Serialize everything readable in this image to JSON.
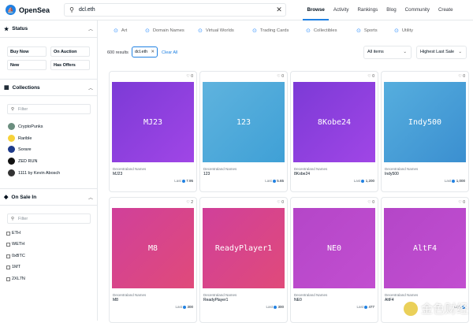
{
  "header": {
    "logo_text": "OpenSea",
    "search_value": "dcl.eth",
    "nav": [
      "Browse",
      "Activity",
      "Rankings",
      "Blog",
      "Community",
      "Create"
    ]
  },
  "sidebar": {
    "status_title": "Status",
    "status_buttons": [
      "Buy Now",
      "On Auction",
      "New",
      "Has Offers"
    ],
    "collections_title": "Collections",
    "collections_filter_placeholder": "Filter",
    "collections": [
      "CryptoPunks",
      "Rarible",
      "Sorare",
      "ZED RUN",
      "1111 by Kevin Abosch"
    ],
    "onsale_title": "On Sale In",
    "onsale_filter_placeholder": "Filter",
    "currencies": [
      "ETH",
      "WETH",
      "0xBTC",
      "1MT",
      "2XL7N"
    ]
  },
  "categories": [
    "Art",
    "Domain Names",
    "Virtual Worlds",
    "Trading Cards",
    "Collectibles",
    "Sports",
    "Utility"
  ],
  "results": {
    "count_text": "600 results",
    "chip": "dcl.eth",
    "clear_all": "Clear All",
    "sort_items": "All items",
    "sort_order": "Highest Last Sale"
  },
  "cards": [
    {
      "title": "MJ23",
      "collection": "Decentraland Names",
      "name": "MJ23",
      "last_label": "Last",
      "last": "7.95",
      "favs": "0",
      "color1": "#7c3ad6",
      "color2": "#a046e6"
    },
    {
      "title": "123",
      "collection": "Decentraland Names",
      "name": "123",
      "last_label": "Last",
      "last": "5.65",
      "favs": "0",
      "color1": "#5fb3de",
      "color2": "#3fa0d6"
    },
    {
      "title": "8Kobe24",
      "collection": "Decentraland Names",
      "name": "8Kobe24",
      "last_label": "Last",
      "last": "1,200",
      "favs": "0",
      "color1": "#7c3ad6",
      "color2": "#a046e6"
    },
    {
      "title": "Indy500",
      "collection": "Decentraland Names",
      "name": "Indy500",
      "last_label": "Last",
      "last": "1,000",
      "favs": "0",
      "color1": "#56aede",
      "color2": "#3b8fd0"
    },
    {
      "title": "M8",
      "collection": "Decentraland Names",
      "name": "M8",
      "last_label": "Last",
      "last": "300",
      "favs": "2",
      "color1": "#d0409a",
      "color2": "#e04a7a"
    },
    {
      "title": "ReadyPlayer1",
      "collection": "Decentraland Names",
      "name": "ReadyPlayer1",
      "last_label": "Last",
      "last": "300",
      "favs": "0",
      "color1": "#d0409a",
      "color2": "#e04a7a"
    },
    {
      "title": "NE0",
      "collection": "Decentraland Names",
      "name": "NE0",
      "last_label": "Last",
      "last": "477",
      "favs": "0",
      "color1": "#b446c8",
      "color2": "#c24ed0"
    },
    {
      "title": "AltF4",
      "collection": "Decentraland Names",
      "name": "AltF4",
      "last_label": "Last",
      "last": "",
      "favs": "0",
      "color1": "#b446c8",
      "color2": "#c24ed0"
    }
  ],
  "watermark": "金色财经"
}
